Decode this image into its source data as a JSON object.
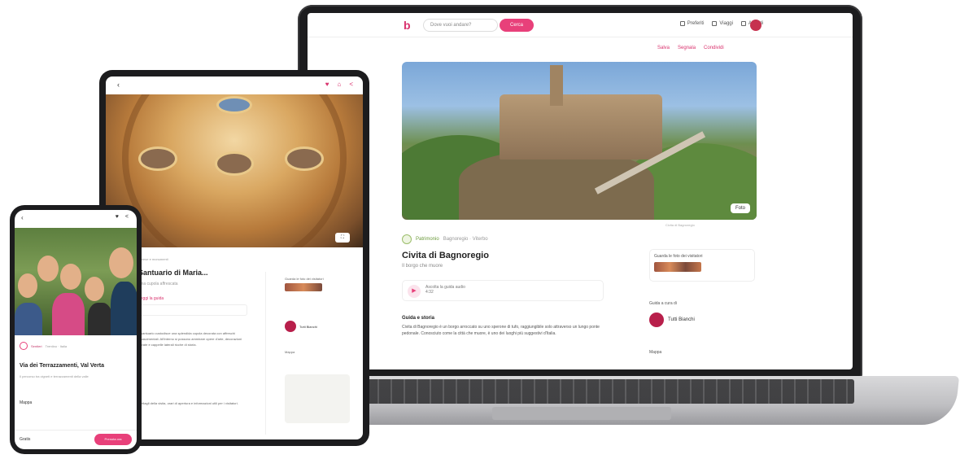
{
  "laptop": {
    "topbar": {
      "logo": "b",
      "search_placeholder": "Dove vuoi andare?",
      "search_button": "Cerca",
      "nav": [
        "Preferiti",
        "Viaggi",
        "Accedi"
      ]
    },
    "actions": [
      "Salva",
      "Segnala",
      "Condividi"
    ],
    "hero_button": "Foto",
    "credit": "Civita di Bagnoregio",
    "category": "Patrimonio",
    "category_meta": "Bagnoregio · Viterbo",
    "title": "Civita di Bagnoregio",
    "subtitle": "Il borgo che muore",
    "audio": {
      "play": "▶",
      "label": "Ascolta la guida audio",
      "time": "4:32"
    },
    "description_heading": "Guida e storia",
    "description": "Civita di Bagnoregio è un borgo arroccato su uno sperone di tufo, raggiungibile solo attraverso un lungo ponte pedonale. Conosciuto come la città che muore, è uno dei luoghi più suggestivi d'Italia.",
    "side_card_label": "Guarda le foto dei visitatori",
    "side_heading": "Guida a cura di",
    "curator": "Tutti Bianchi",
    "side_heading2": "Mappa"
  },
  "tablet": {
    "back": "‹",
    "icons": [
      "♥",
      "⌂",
      "<"
    ],
    "photo_button": "⛶",
    "category": "Chiese e monumenti",
    "title": "Santuario di Maria...",
    "subtitle": "Una cupola affrescata",
    "link": "Leggi la guida",
    "text": "Il santuario custodisce una splendida cupola decorata con affreschi rinascimentali. All'interno si possono ammirare opere d'arte, decorazioni dorate e cappelle laterali ricche di storia.",
    "text2": "Dettagli della visita, orari di apertura e informazioni utili per i visitatori.",
    "side_label": "Guarda le foto dei visitatori",
    "curator": "Tutti Bianchi",
    "map_label": "Mappa"
  },
  "phone": {
    "back": "‹",
    "icons": [
      "♥",
      "<"
    ],
    "category": "Sentieri",
    "category_meta": "Trentino · Italia",
    "title": "Via dei Terrazzamenti, Val Verta",
    "subtitle": "Il percorso tra vigneti e terrazzamenti della valle",
    "link": "Mappa",
    "price": "Gratis",
    "cta": "Prenota ora"
  }
}
